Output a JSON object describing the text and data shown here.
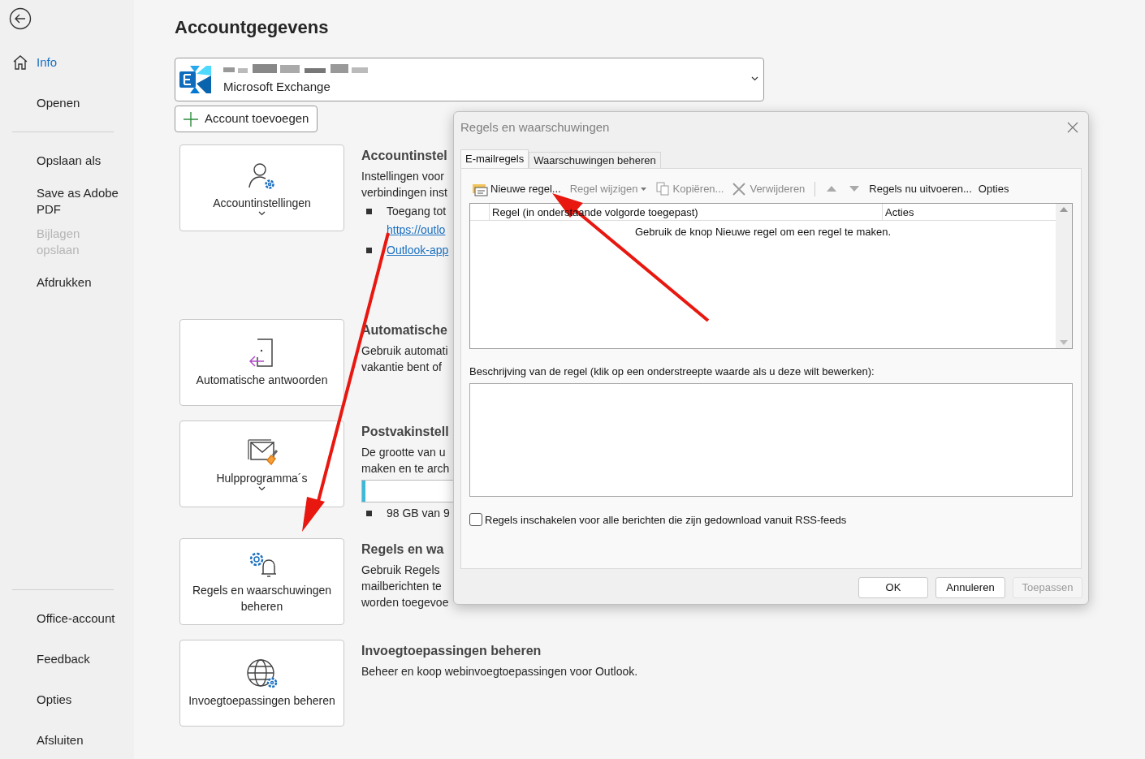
{
  "sidebar": {
    "top_items": [
      {
        "label": "Info",
        "selected": true,
        "disabled": false
      },
      {
        "label": "Openen",
        "selected": false,
        "disabled": false
      }
    ],
    "middle_items": [
      {
        "label": "Opslaan als",
        "selected": false,
        "disabled": false
      },
      {
        "label": "Save as Adobe PDF",
        "selected": false,
        "disabled": false
      },
      {
        "label": "Bijlagen opslaan",
        "selected": false,
        "disabled": true
      },
      {
        "label": "Afdrukken",
        "selected": false,
        "disabled": false
      }
    ],
    "bottom_items": [
      {
        "label": "Office-account",
        "selected": false,
        "disabled": false
      },
      {
        "label": "Feedback",
        "selected": false,
        "disabled": false
      },
      {
        "label": "Opties",
        "selected": false,
        "disabled": false
      },
      {
        "label": "Afsluiten",
        "selected": false,
        "disabled": false
      }
    ]
  },
  "page_title": "Accountgegevens",
  "account": {
    "type": "Microsoft Exchange"
  },
  "add_account": "Account toevoegen",
  "sections": [
    {
      "card_label": "Accountinstellingen",
      "menu": true,
      "title": "Accountinstel",
      "body": [
        {
          "kind": "text",
          "text": "Instellingen voor"
        },
        {
          "kind": "text",
          "text": "verbindingen inst"
        },
        {
          "kind": "bullet",
          "text": "Toegang tot"
        },
        {
          "kind": "link",
          "text": "https://outlo"
        },
        {
          "kind": "link_bullet",
          "text": "Outlook-app"
        }
      ]
    },
    {
      "card_label": "Automatische antwoorden",
      "menu": false,
      "title": "Automatische",
      "body": [
        {
          "kind": "text",
          "text": "Gebruik automati"
        },
        {
          "kind": "text",
          "text": "vakantie bent of"
        }
      ]
    },
    {
      "card_label": "Hulpprogramma´s",
      "menu": true,
      "title": "Postvakinstell",
      "body": [
        {
          "kind": "text",
          "text": "De grootte van u"
        },
        {
          "kind": "text",
          "text": "maken en te arch"
        },
        {
          "kind": "progress",
          "level": 0.03
        },
        {
          "kind": "bullet",
          "text": "98 GB van 9"
        }
      ]
    },
    {
      "card_label": "Regels en waarschuwingen beheren",
      "menu": false,
      "title": "Regels en wa",
      "body": [
        {
          "kind": "text",
          "text": "Gebruik Regels"
        },
        {
          "kind": "text",
          "text": "mailberichten te"
        },
        {
          "kind": "text",
          "text": "worden toegevoe"
        }
      ]
    },
    {
      "card_label": "Invoegtoepassingen beheren",
      "menu": false,
      "title": "Invoegtoepassingen beheren",
      "body": [
        {
          "kind": "text",
          "text": "Beheer en koop webinvoegtoepassingen voor Outlook."
        }
      ]
    }
  ],
  "dialog": {
    "title": "Regels en waarschuwingen",
    "tabs": [
      {
        "label": "E-mailregels",
        "selected": true
      },
      {
        "label": "Waarschuwingen beheren",
        "selected": false
      }
    ],
    "toolbar": [
      {
        "kind": "new",
        "label": "Nieuwe regel...",
        "disabled": false
      },
      {
        "kind": "dropdown",
        "label": "Regel wijzigen",
        "disabled": true
      },
      {
        "kind": "copy",
        "label": "Kopiëren...",
        "disabled": true
      },
      {
        "kind": "delete",
        "label": "Verwijderen",
        "disabled": true
      },
      {
        "kind": "separator"
      },
      {
        "kind": "up",
        "disabled": true
      },
      {
        "kind": "down",
        "disabled": true
      },
      {
        "kind": "text",
        "label": "Regels nu uitvoeren...",
        "disabled": false
      },
      {
        "kind": "text",
        "label": "Opties",
        "disabled": false
      }
    ],
    "columns": [
      "Regel (in onderstaande volgorde toegepast)",
      "Acties"
    ],
    "empty_message": "Gebruik de knop Nieuwe regel om een regel te maken.",
    "description_label": "Beschrijving van de regel (klik op een onderstreepte waarde als u deze wilt bewerken):",
    "rss": {
      "label": "Regels inschakelen voor alle berichten die zijn gedownload vanuit RSS-feeds",
      "checked": false
    },
    "buttons": [
      {
        "label": "OK",
        "disabled": false
      },
      {
        "label": "Annuleren",
        "disabled": false
      },
      {
        "label": "Toepassen",
        "disabled": true
      }
    ]
  }
}
